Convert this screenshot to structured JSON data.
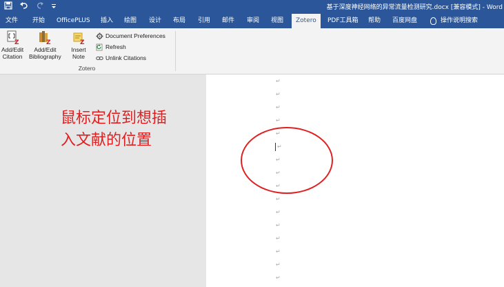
{
  "app": {
    "title": "基于深度神经网络的异常流量检测研究.docx [兼容模式] - Word",
    "quick_access": {
      "save_icon": "save-icon",
      "undo_icon": "undo-icon",
      "redo_icon": "redo-icon",
      "customize_icon": "customize-qat-icon"
    }
  },
  "tabs": [
    {
      "label": "文件"
    },
    {
      "label": "开始"
    },
    {
      "label": "OfficePLUS"
    },
    {
      "label": "插入"
    },
    {
      "label": "绘图"
    },
    {
      "label": "设计"
    },
    {
      "label": "布局"
    },
    {
      "label": "引用"
    },
    {
      "label": "邮件"
    },
    {
      "label": "审阅"
    },
    {
      "label": "视图"
    },
    {
      "label": "Zotero",
      "active": true
    },
    {
      "label": "PDF工具箱"
    },
    {
      "label": "帮助"
    },
    {
      "label": "百度网盘"
    }
  ],
  "tell_me": {
    "label": "操作说明搜索",
    "icon": "lightbulb-icon"
  },
  "ribbon": {
    "group_label": "Zotero",
    "add_edit_citation": {
      "line1": "Add/Edit",
      "line2": "Citation"
    },
    "add_edit_bibliography": {
      "line1": "Add/Edit",
      "line2": "Bibliography"
    },
    "insert_note": {
      "line1": "Insert",
      "line2": "Note"
    },
    "document_preferences": "Document Preferences",
    "refresh": "Refresh",
    "unlink_citations": "Unlink Citations"
  },
  "document": {
    "paragraph_mark": "↵",
    "annotation_line1": "鼠标定位到想插",
    "annotation_line2": "入文献的位置"
  },
  "colors": {
    "word_blue": "#2b579a",
    "ribbon_bg": "#f3f3f3",
    "annotation_red": "#e02020"
  }
}
